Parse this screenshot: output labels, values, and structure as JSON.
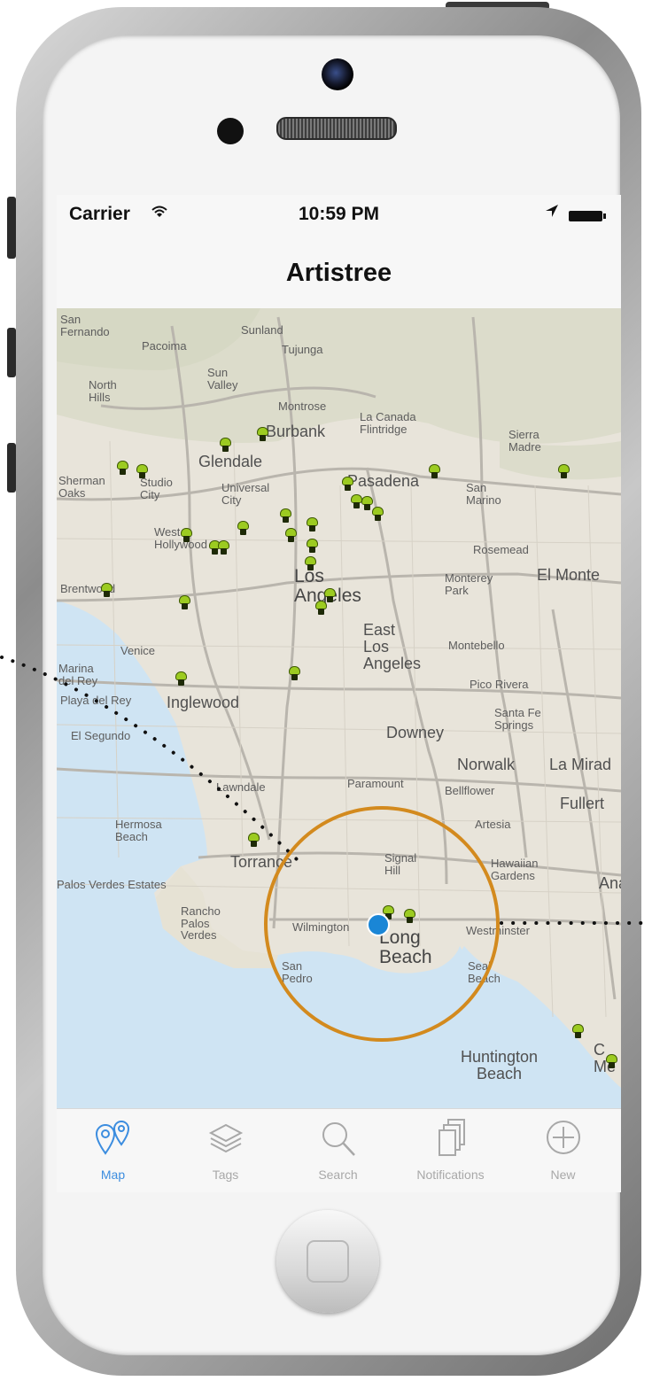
{
  "status_bar": {
    "carrier": "Carrier",
    "time": "10:59 PM",
    "wifi_icon": "wifi-icon",
    "location_icon": "location-arrow-icon",
    "battery_icon": "battery-icon"
  },
  "nav": {
    "title": "Artistree"
  },
  "map": {
    "labels": {
      "san_fernando": "San\nFernando",
      "pacoima": "Pacoima",
      "sunland": "Sunland",
      "tujunga": "Tujunga",
      "sun_valley": "Sun\nValley",
      "north_hills": "North\nHills",
      "montrose": "Montrose",
      "burbank": "Burbank",
      "la_canada": "La Canada\nFlintridge",
      "sierra_madre": "Sierra\nMadre",
      "glendale": "Glendale",
      "sherman_oaks": "Sherman\nOaks",
      "studio_city": "Studio\nCity",
      "universal_city": "Universal\nCity",
      "pasadena": "Pasadena",
      "san_marino": "San\nMarino",
      "west_hollywood": "West\nHollywood",
      "rosemead": "Rosemead",
      "los_angeles": "Los\nAngeles",
      "brentwood": "Brentwood",
      "monterey_park": "Monterey\nPark",
      "el_monte": "El Monte",
      "venice": "Venice",
      "east_los_angeles": "East\nLos\nAngeles",
      "montebello": "Montebello",
      "marina_del_rey": "Marina\ndel Rey",
      "playa_del_rey": "Playa del Rey",
      "pico_rivera": "Pico Rivera",
      "inglewood": "Inglewood",
      "santa_fe_springs": "Santa Fe\nSprings",
      "el_segundo": "El Segundo",
      "downey": "Downey",
      "norwalk": "Norwalk",
      "la_mirada": "La Mirad",
      "lawndale": "Lawndale",
      "paramount": "Paramount",
      "bellflower": "Bellflower",
      "fullerton": "Fullert",
      "hermosa_beach": "Hermosa\nBeach",
      "artesia": "Artesia",
      "torrance": "Torrance",
      "signal_hill": "Signal\nHill",
      "hawaiian_gardens": "Hawaiian\nGardens",
      "ana": "Ana",
      "palos_verdes_estates": "Palos Verdes Estates",
      "rancho_palos_verdes": "Rancho\nPalos\nVerdes",
      "wilmington": "Wilmington",
      "long_beach": "Long\nBeach",
      "westminster": "Westminster",
      "san_pedro": "San\nPedro",
      "seal_beach": "Seal\nBeach",
      "huntington_beach": "Huntington\nBeach",
      "costa_mesa": "C\nMe"
    },
    "pin_icon": "map-pin-icon",
    "current_location_icon": "current-location-icon"
  },
  "tabs": [
    {
      "label": "Map",
      "icon": "map-pins-icon",
      "active": true
    },
    {
      "label": "Tags",
      "icon": "layers-icon",
      "active": false
    },
    {
      "label": "Search",
      "icon": "search-icon",
      "active": false
    },
    {
      "label": "Notifications",
      "icon": "notifications-icon",
      "active": false
    },
    {
      "label": "New",
      "icon": "plus-circle-icon",
      "active": false
    }
  ],
  "colors": {
    "accent": "#3c8ddf",
    "pin": "#9ccb21",
    "highlight_circle": "#d38a1e",
    "water": "#cfe4f3",
    "land": "#e8e4da"
  }
}
